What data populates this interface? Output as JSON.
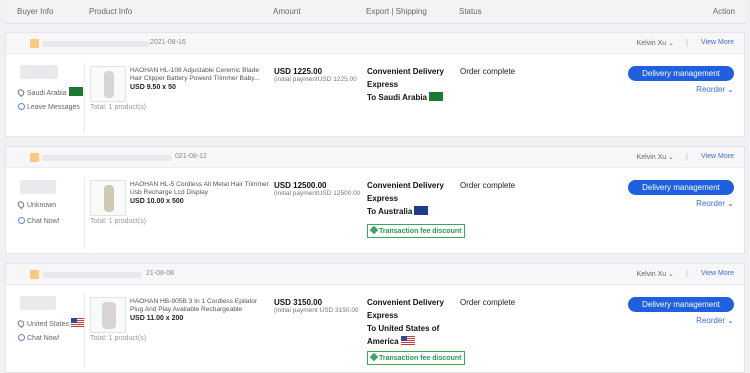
{
  "header": {
    "buyer": "Buyer Info",
    "product": "Product Info",
    "amount": "Amount",
    "export": "Export | Shipping",
    "status": "Status",
    "action": "Action"
  },
  "orders": [
    {
      "date": "2021-08-16",
      "user": "Kelvin Xu ",
      "view_more": "View More",
      "location": "Saudi Arabia",
      "message": "Leave Messages",
      "product_name": "HAOHAN HL-108 Adjustable Ceremic Blade Hair Clipper Battery Powerd Trimmer Baby...",
      "product_price": "USD 9.50 x 50",
      "total": "Total:  1 product(s)",
      "amount": "USD 1225.00",
      "amount_sub": "(initial paymentUSD 1225.00",
      "ship_line1": "Convenient Delivery",
      "ship_line2": "Express",
      "ship_to": "To Saudi Arabia",
      "status": "Order complete",
      "button": "Delivery management",
      "reorder": "Reorder "
    },
    {
      "date": "021-08-12",
      "user": "Kelvin Xu ",
      "view_more": "View More",
      "location": "Unknown",
      "message": "Chat Now!",
      "product_name": "HAOHAN HL-5 Cordless All Metal Hair Trimmer Usb Recharge Lcd Display",
      "product_price": "USD 10.00 x 500",
      "total": "Total:  1 product(s)",
      "amount": "USD 12500.00",
      "amount_sub": "(initial paymentUSD 12500.00",
      "ship_line1": "Convenient Delivery",
      "ship_line2": "Express",
      "ship_to": "To Australia",
      "badge": "Transaction fee discount",
      "status": "Order complete",
      "button": "Delivery management",
      "reorder": "Reorder "
    },
    {
      "date": "21-08-08",
      "user": "Kelvin Xu ",
      "view_more": "View More",
      "location": "United States",
      "message": "Chat Now!",
      "product_name": "HAOHAN HB-905B 3 In 1 Cordless Epilator Plug And Play Available Rechargeable",
      "product_price": "USD 11.00 x 200",
      "total": "Total:  1 product(s)",
      "amount": "USD 3150.00",
      "amount_sub": "(initial payment USD 3150.00",
      "ship_line1": "Convenient Delivery",
      "ship_line2": "Express",
      "ship_to_line1": "To United States of",
      "ship_to_line2": "America",
      "badge": "Transaction fee discount",
      "status": "Order complete",
      "button": "Delivery management",
      "reorder": "Reorder "
    }
  ],
  "colors": {
    "accent": "#1f5fe0",
    "link": "#3a6ed6",
    "badge": "#39a861",
    "highlight": "#f9c97d"
  }
}
